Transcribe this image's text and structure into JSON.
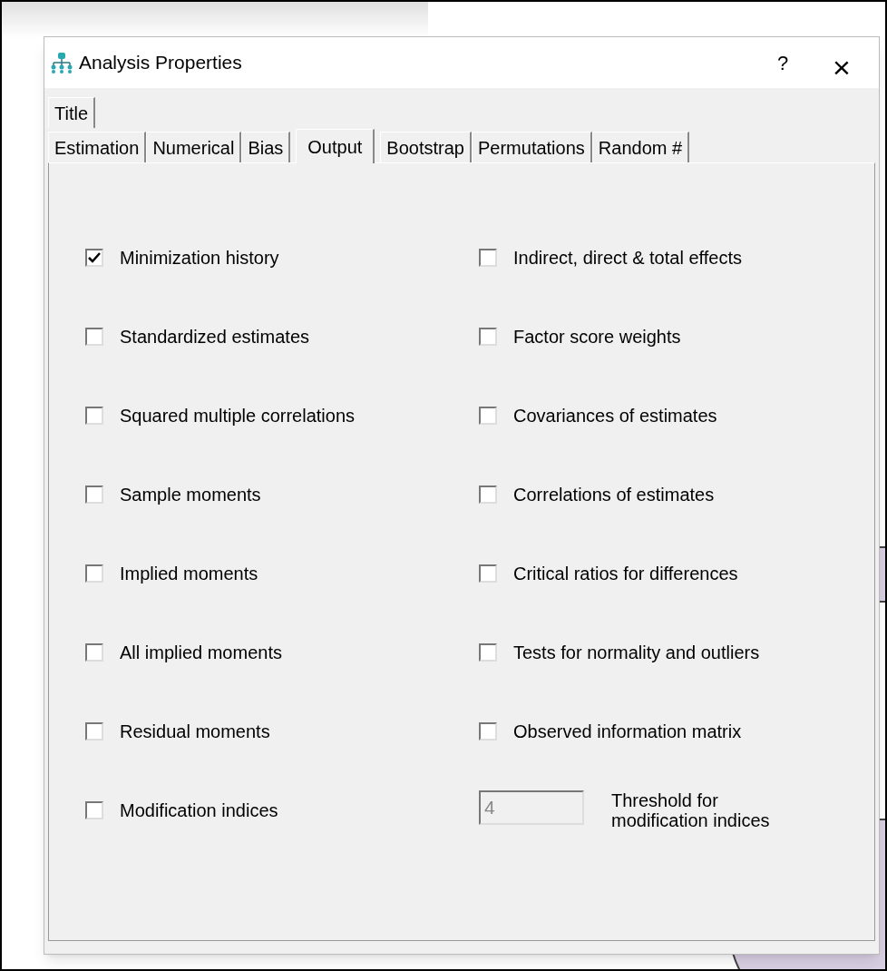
{
  "window": {
    "title": "Analysis Properties"
  },
  "title_bar_buttons": [
    {
      "kind": "help",
      "label": "?"
    },
    {
      "kind": "close",
      "label": "×"
    }
  ],
  "tab_rows": [
    [
      {
        "label": "Title",
        "selected": false
      }
    ],
    [
      {
        "label": "Estimation",
        "selected": false
      },
      {
        "label": "Numerical",
        "selected": false
      },
      {
        "label": "Bias",
        "selected": false
      },
      {
        "label": "Output",
        "selected": true
      },
      {
        "label": "Bootstrap",
        "selected": false
      },
      {
        "label": "Permutations",
        "selected": false
      },
      {
        "label": "Random #",
        "selected": false
      }
    ]
  ],
  "left_options": [
    {
      "label": "Minimization history",
      "checked": true
    },
    {
      "label": "Standardized estimates",
      "checked": false
    },
    {
      "label": "Squared multiple correlations",
      "checked": false
    },
    {
      "label": "Sample moments",
      "checked": false
    },
    {
      "label": "Implied moments",
      "checked": false
    },
    {
      "label": "All implied moments",
      "checked": false
    },
    {
      "label": "Residual moments",
      "checked": false
    },
    {
      "label": "Modification indices",
      "checked": false
    }
  ],
  "right_options": [
    {
      "label": "Indirect, direct & total effects",
      "checked": false
    },
    {
      "label": "Factor score weights",
      "checked": false
    },
    {
      "label": "Covariances of estimates",
      "checked": false
    },
    {
      "label": "Correlations of estimates",
      "checked": false
    },
    {
      "label": "Critical ratios for differences",
      "checked": false
    },
    {
      "label": "Tests for normality and outliers",
      "checked": false
    },
    {
      "label": "Observed information matrix",
      "checked": false
    }
  ],
  "threshold": {
    "value": "4",
    "disabled": true,
    "label": "Threshold for modification indices"
  }
}
